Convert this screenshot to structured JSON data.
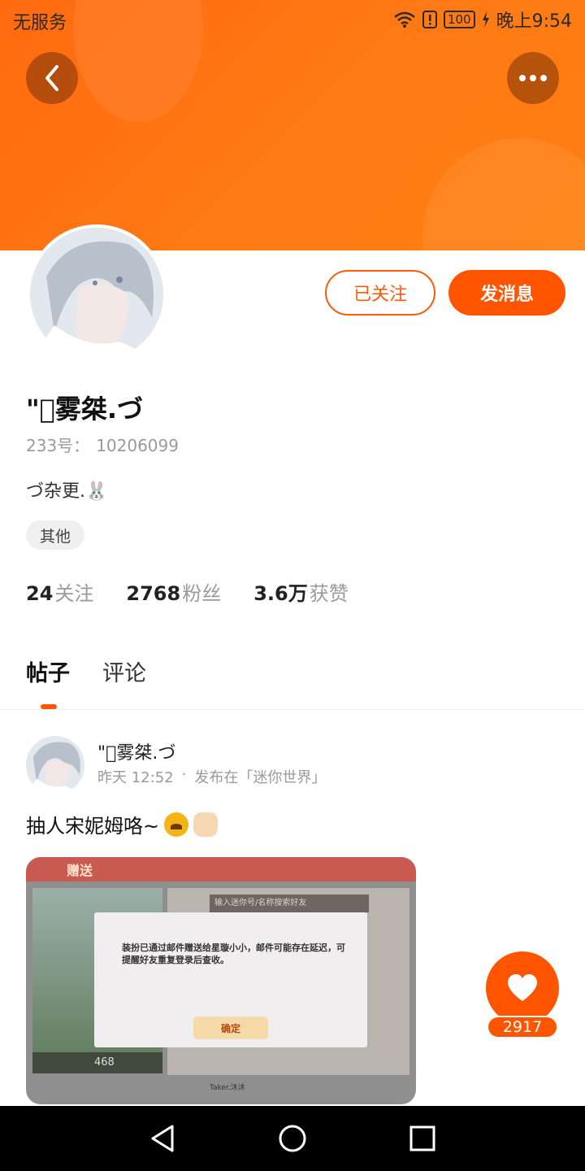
{
  "status_bar": {
    "carrier": "无服务",
    "battery": "100",
    "time": "晚上9:54"
  },
  "header": {
    "colors": {
      "primary": "#ff5500",
      "accent": "#ff7a14"
    }
  },
  "profile": {
    "name": "\"\u0000雾桀.づ",
    "id_label": "233号：",
    "id_value": "10206099",
    "bio": "づ杂更.🐰",
    "tag": "其他",
    "follow_button": "已关注",
    "message_button": "发消息",
    "stats": [
      {
        "value": "24",
        "label": "关注"
      },
      {
        "value": "2768",
        "label": "粉丝"
      },
      {
        "value": "3.6万",
        "label": "获赞"
      }
    ]
  },
  "tabs": [
    {
      "label": "帖子",
      "active": true
    },
    {
      "label": "评论",
      "active": false
    }
  ],
  "post": {
    "author": "\"\u0000雾桀.づ",
    "time": "昨天 12:52",
    "separator": "·",
    "location": "发布在「迷你世界」",
    "text": "抽人宋妮姆咯~",
    "image": {
      "header": "赠送",
      "search_placeholder": "输入迷你号/名称搜索好友",
      "dialog_text": "装扮已通过邮件赠送给星璇小小，邮件可能存在延迟，可提醒好友重复登录后查收。",
      "ok_button": "确定",
      "coins": "468",
      "friend_name": "Taker.沐沐"
    }
  },
  "like": {
    "count": "2917"
  },
  "icons": {
    "back": "back-icon",
    "more": "more-icon",
    "heart": "heart-icon",
    "wifi": "wifi-icon",
    "alert": "alert-icon",
    "charging": "charging-icon"
  }
}
